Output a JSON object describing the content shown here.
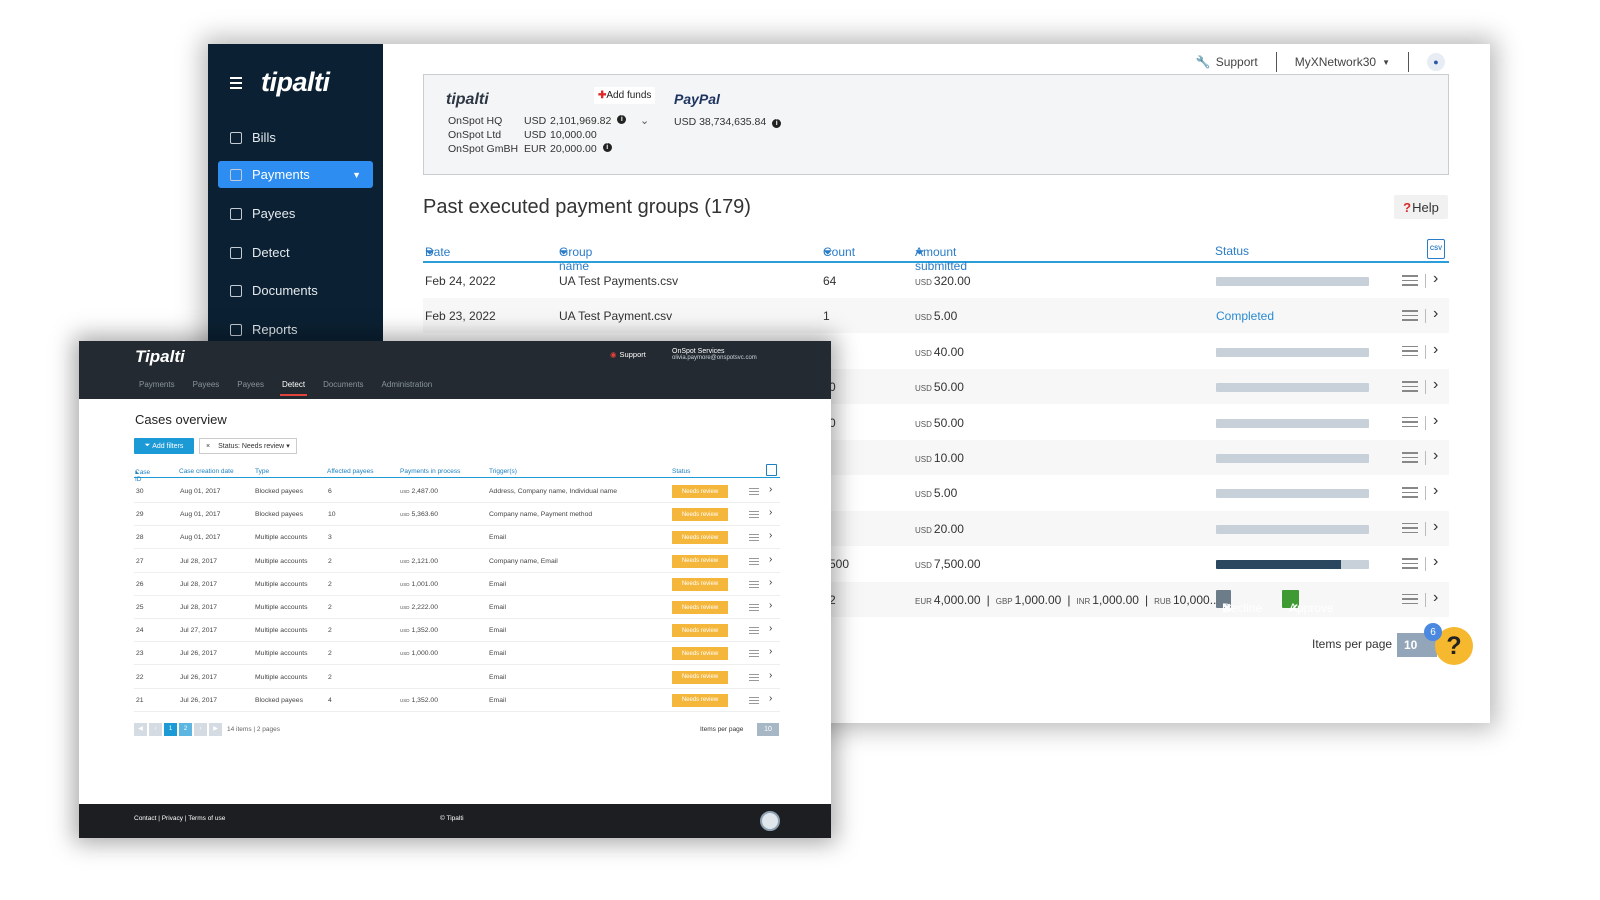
{
  "back": {
    "logo": "tipalti",
    "nav": [
      {
        "label": "Bills",
        "icon": "bills-icon"
      },
      {
        "label": "Payments",
        "icon": "payments-icon",
        "active": true
      },
      {
        "label": "Payees",
        "icon": "payees-icon"
      },
      {
        "label": "Detect",
        "icon": "detect-icon"
      },
      {
        "label": "Documents",
        "icon": "documents-icon"
      },
      {
        "label": "Reports",
        "icon": "reports-icon"
      }
    ],
    "topbar": {
      "support": "Support",
      "account": "MyXNetwork30"
    },
    "funds": {
      "logo": "tipalti",
      "add_funds": "Add funds",
      "entities": [
        {
          "name": "OnSpot HQ",
          "currency": "USD",
          "amount": "2,101,969.82"
        },
        {
          "name": "OnSpot Ltd",
          "currency": "USD",
          "amount": "10,000.00"
        },
        {
          "name": "OnSpot GmBH",
          "currency": "EUR",
          "amount": "20,000.00"
        }
      ],
      "paypal_label": "PayPal",
      "paypal_balance": "USD 38,734,635.84"
    },
    "page_title": "Past executed payment groups (179)",
    "help": "Help",
    "columns": {
      "date": "Date",
      "group": "Group name",
      "count": "Count",
      "amount": "Amount submitted",
      "status": "Status"
    },
    "rows": [
      {
        "date": "Feb 24, 2022",
        "group": "UA Test Payments.csv",
        "count": "64",
        "amount": "320.00",
        "progress": 0
      },
      {
        "date": "Feb 23, 2022",
        "group": "UA Test Payment.csv",
        "count": "1",
        "amount": "5.00",
        "status": "Completed"
      },
      {
        "count": "",
        "amount": "40.00",
        "progress": 0
      },
      {
        "count": "0",
        "amount": "50.00",
        "progress": 0
      },
      {
        "count": "0",
        "amount": "50.00",
        "progress": 0
      },
      {
        "count": "",
        "amount": "10.00",
        "progress": 0
      },
      {
        "count": "",
        "amount": "5.00",
        "progress": 0
      },
      {
        "count": "",
        "amount": "20.00",
        "progress": 0
      },
      {
        "count": "500",
        "amount": "7,500.00",
        "progress": 0.82
      },
      {
        "count": "2",
        "multi": true
      }
    ],
    "multi_amount": [
      {
        "cur": "EUR",
        "val": "4,000.00"
      },
      {
        "cur": "GBP",
        "val": "1,000.00"
      },
      {
        "cur": "INR",
        "val": "1,000.00"
      },
      {
        "cur": "RUB",
        "val": "10,000..."
      }
    ],
    "currency": "USD",
    "decline": "Decline",
    "approve": "Approve",
    "items_per_page": "Items per page",
    "ipp_value": "10",
    "notif_count": "6",
    "help_glyph": "?"
  },
  "front": {
    "logo": "Tipalti",
    "nav": [
      "Payments",
      "Payees",
      "Payees",
      "Detect",
      "Documents",
      "Administration"
    ],
    "nav_active": "Detect",
    "support": "Support",
    "account_name": "OnSpot Services",
    "account_email": "olivia.paymore@onspotsvc.com",
    "title": "Cases overview",
    "add_filters": "Add filters",
    "filter_chip": "Status: Needs review",
    "columns": {
      "id": "Case ID",
      "date": "Case creation date",
      "type": "Type",
      "affected": "Affected payees",
      "payments": "Payments in process",
      "trigger": "Trigger(s)",
      "status": "Status"
    },
    "rows": [
      {
        "id": "30",
        "date": "Aug 01, 2017",
        "type": "Blocked payees",
        "affected": "6",
        "payments": "2,487.00",
        "trigger": "Address, Company name, Individual name"
      },
      {
        "id": "29",
        "date": "Aug 01, 2017",
        "type": "Blocked payees",
        "affected": "10",
        "payments": "5,363.60",
        "trigger": "Company name, Payment method"
      },
      {
        "id": "28",
        "date": "Aug 01, 2017",
        "type": "Multiple accounts",
        "affected": "3",
        "payments": "",
        "trigger": "Email"
      },
      {
        "id": "27",
        "date": "Jul 28, 2017",
        "type": "Multiple accounts",
        "affected": "2",
        "payments": "2,121.00",
        "trigger": "Company name, Email"
      },
      {
        "id": "26",
        "date": "Jul 28, 2017",
        "type": "Multiple accounts",
        "affected": "2",
        "payments": "1,001.00",
        "trigger": "Email"
      },
      {
        "id": "25",
        "date": "Jul 28, 2017",
        "type": "Multiple accounts",
        "affected": "2",
        "payments": "2,222.00",
        "trigger": "Email"
      },
      {
        "id": "24",
        "date": "Jul 27, 2017",
        "type": "Multiple accounts",
        "affected": "2",
        "payments": "1,352.00",
        "trigger": "Email"
      },
      {
        "id": "23",
        "date": "Jul 26, 2017",
        "type": "Multiple accounts",
        "affected": "2",
        "payments": "1,000.00",
        "trigger": "Email"
      },
      {
        "id": "22",
        "date": "Jul 26, 2017",
        "type": "Multiple accounts",
        "affected": "2",
        "payments": "",
        "trigger": "Email"
      },
      {
        "id": "21",
        "date": "Jul 26, 2017",
        "type": "Blocked payees",
        "affected": "4",
        "payments": "1,352.00",
        "trigger": "Email"
      }
    ],
    "currency": "USD",
    "status_label": "Needs review",
    "pages": [
      "1",
      "2"
    ],
    "page_info": "14 items | 2 pages",
    "items_per_page": "Items per page",
    "ipp_value": "10",
    "footer_links": "Contact  |  Privacy  |  Terms of use",
    "copyright": "© Tipalti"
  },
  "colors": {
    "sidebar": "#0b2133",
    "accent": "#2e8df0",
    "approve": "#3f9a34",
    "needs_review": "#f4b73b"
  }
}
